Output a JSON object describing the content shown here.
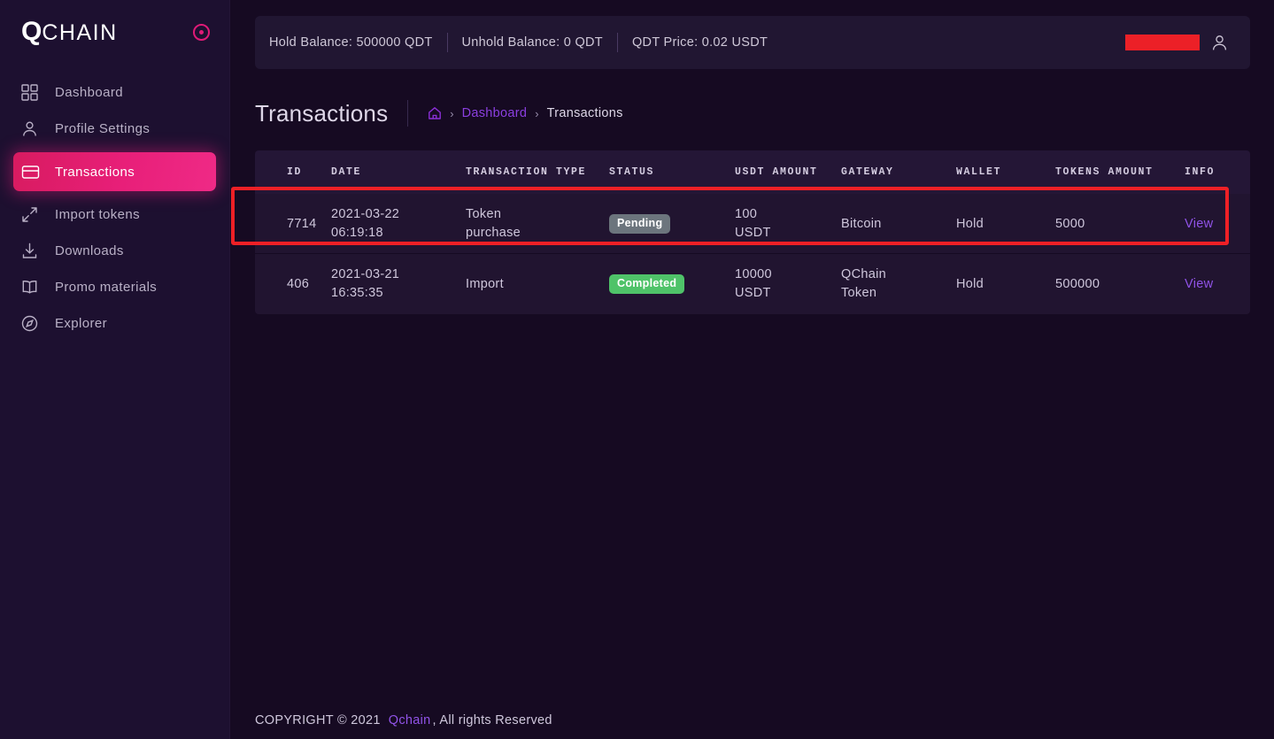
{
  "sidebar": {
    "brand": {
      "q": "Q",
      "rest": "CHAIN",
      "toggle_icon": "circle-dot-icon"
    },
    "items": [
      {
        "label": "Dashboard",
        "icon": "grid-icon",
        "active": false
      },
      {
        "label": "Profile Settings",
        "icon": "user-icon",
        "active": false
      },
      {
        "label": "Transactions",
        "icon": "credit-card-icon",
        "active": true
      },
      {
        "label": "Import tokens",
        "icon": "expand-arrows-icon",
        "active": false
      },
      {
        "label": "Downloads",
        "icon": "download-icon",
        "active": false
      },
      {
        "label": "Promo materials",
        "icon": "book-icon",
        "active": false
      },
      {
        "label": "Explorer",
        "icon": "compass-icon",
        "active": false
      }
    ]
  },
  "topbar": {
    "hold_balance": "Hold Balance: 500000 QDT",
    "unhold_balance": "Unhold Balance: 0 QDT",
    "qdt_price": "QDT Price: 0.02 USDT",
    "username_redacted": "",
    "avatar_icon": "user-avatar-icon"
  },
  "page": {
    "title": "Transactions",
    "breadcrumb": {
      "home_icon": "home-icon",
      "separator": "›",
      "link": "Dashboard",
      "current": "Transactions"
    }
  },
  "table": {
    "headers": [
      "ID",
      "DATE",
      "TRANSACTION TYPE",
      "STATUS",
      "USDT AMOUNT",
      "GATEWAY",
      "WALLET",
      "TOKENS AMOUNT",
      "INFO"
    ],
    "rows": [
      {
        "id": "7714",
        "date_line1": "2021-03-22",
        "date_line2": "06:19:18",
        "type_line1": "Token",
        "type_line2": "purchase",
        "status": "Pending",
        "status_kind": "pending",
        "usdt_line1": "100",
        "usdt_line2": "USDT",
        "gateway_line1": "Bitcoin",
        "gateway_line2": "",
        "wallet": "Hold",
        "tokens": "5000",
        "info": "View",
        "highlighted": true
      },
      {
        "id": "406",
        "date_line1": "2021-03-21",
        "date_line2": "16:35:35",
        "type_line1": "Import",
        "type_line2": "",
        "status": "Completed",
        "status_kind": "completed",
        "usdt_line1": "10000",
        "usdt_line2": "USDT",
        "gateway_line1": "QChain",
        "gateway_line2": "Token",
        "wallet": "Hold",
        "tokens": "500000",
        "info": "View",
        "highlighted": false
      }
    ]
  },
  "footer": {
    "prefix": "COPYRIGHT © 2021",
    "link": "Qchain",
    "suffix": ", All rights Reserved"
  },
  "colors": {
    "accent_pink": "#e81f79",
    "purple_link": "#9153e8",
    "badge_pending": "#6c757d",
    "badge_completed": "#4fc369",
    "highlight_red": "#ef2026",
    "page_bg": "#160a22",
    "sidebar_bg": "#1d1030",
    "card_bg": "#211632"
  }
}
